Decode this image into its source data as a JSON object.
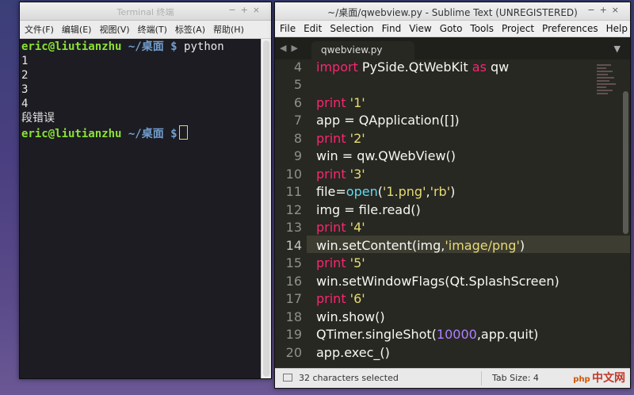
{
  "terminal": {
    "title": "Terminal 终端",
    "menu": [
      "文件(F)",
      "编辑(E)",
      "视图(V)",
      "终端(T)",
      "标签(A)",
      "帮助(H)"
    ],
    "prompt_user": "eric@liutianzhu",
    "prompt_path": "~/桌面",
    "prompt_symbol": "$",
    "command": "python",
    "output": [
      "1",
      "2",
      "3",
      "4",
      "段错误"
    ]
  },
  "sublime": {
    "title": "~/桌面/qwebview.py - Sublime Text (UNREGISTERED)",
    "menu": [
      "File",
      "Edit",
      "Selection",
      "Find",
      "View",
      "Goto",
      "Tools",
      "Project",
      "Preferences",
      "Help"
    ],
    "tab_name": "qwebview.py",
    "line_numbers": [
      "4",
      "5",
      "6",
      "7",
      "8",
      "9",
      "10",
      "11",
      "12",
      "13",
      "14",
      "15",
      "16",
      "17",
      "18",
      "19",
      "20"
    ],
    "code": {
      "l4a": "import",
      "l4b": " PySide.QtWebKit ",
      "l4c": "as",
      "l4d": " qw",
      "l6a": "print",
      "l6b": " '1'",
      "l7": "app = QApplication([])",
      "l8a": "print",
      "l8b": " '2'",
      "l9": "win = qw.QWebView()",
      "l10a": "print",
      "l10b": " '3'",
      "l11a": "file=",
      "l11b": "open",
      "l11c": "(",
      "l11d": "'1.png'",
      "l11e": ",",
      "l11f": "'rb'",
      "l11g": ")",
      "l12": "img = file.read()",
      "l13a": "print",
      "l13b": " '4'",
      "l14a": "win.setContent(img,",
      "l14b": "'image/png'",
      "l14c": ")",
      "l15a": "print",
      "l15b": " '5'",
      "l16": "win.setWindowFlags(Qt.SplashScreen)",
      "l17a": "print",
      "l17b": " '6'",
      "l18": "win.show()",
      "l19a": "QTimer.singleShot(",
      "l19b": "10000",
      "l19c": ",app.quit)",
      "l20": "app.exec_()"
    },
    "status_text": "32 characters selected",
    "tab_size": "Tab Size: 4",
    "watermark": "中文网",
    "watermark_logo": "php"
  }
}
